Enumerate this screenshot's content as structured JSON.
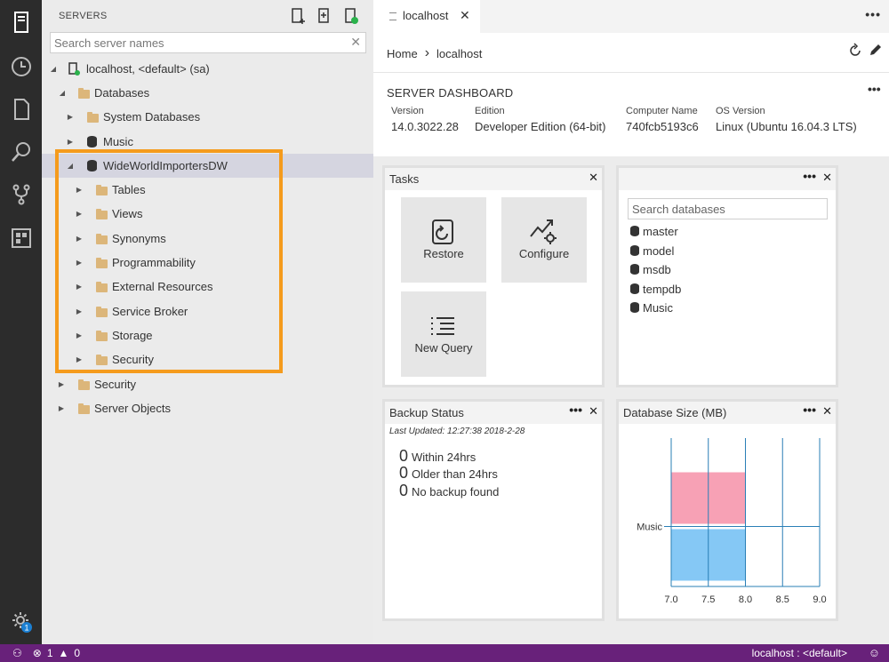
{
  "activity_bar": {
    "items": [
      "servers-icon",
      "history-icon",
      "explorer-icon",
      "search-icon",
      "source-control-icon",
      "extensions-icon"
    ],
    "settings_badge": "1"
  },
  "sidebar": {
    "title": "SERVERS",
    "search_placeholder": "Search server names",
    "tree": [
      {
        "label": "localhost, <default> (sa)",
        "icon": "server-icon",
        "expanded": true
      },
      {
        "label": "Databases",
        "icon": "folder-icon",
        "expanded": true
      },
      {
        "label": "System Databases",
        "icon": "folder-icon",
        "expanded": false
      },
      {
        "label": "Music",
        "icon": "database-icon",
        "expanded": false
      },
      {
        "label": "WideWorldImportersDW",
        "icon": "database-icon",
        "expanded": true,
        "selected": true
      },
      {
        "label": "Tables",
        "icon": "folder-icon",
        "expanded": false
      },
      {
        "label": "Views",
        "icon": "folder-icon",
        "expanded": false
      },
      {
        "label": "Synonyms",
        "icon": "folder-icon",
        "expanded": false
      },
      {
        "label": "Programmability",
        "icon": "folder-icon",
        "expanded": false
      },
      {
        "label": "External Resources",
        "icon": "folder-icon",
        "expanded": false
      },
      {
        "label": "Service Broker",
        "icon": "folder-icon",
        "expanded": false
      },
      {
        "label": "Storage",
        "icon": "folder-icon",
        "expanded": false
      },
      {
        "label": "Security",
        "icon": "folder-icon",
        "expanded": false
      },
      {
        "label": "Security",
        "icon": "folder-icon",
        "expanded": false
      },
      {
        "label": "Server Objects",
        "icon": "folder-icon",
        "expanded": false
      }
    ]
  },
  "tab": {
    "label": "localhost"
  },
  "breadcrumb": {
    "home": "Home",
    "current": "localhost"
  },
  "dashboard": {
    "title": "SERVER DASHBOARD",
    "properties": [
      {
        "key": "Version",
        "value": "14.0.3022.28"
      },
      {
        "key": "Edition",
        "value": "Developer Edition (64-bit)"
      },
      {
        "key": "Computer Name",
        "value": "740fcb5193c6"
      },
      {
        "key": "OS Version",
        "value": "Linux (Ubuntu 16.04.3 LTS)"
      }
    ]
  },
  "tasks_widget": {
    "title": "Tasks",
    "tasks": [
      {
        "label": "Restore",
        "icon": "restore-icon"
      },
      {
        "label": "Configure",
        "icon": "configure-icon"
      },
      {
        "label": "New Query",
        "icon": "new-query-icon"
      }
    ]
  },
  "databases_widget": {
    "search_placeholder": "Search databases",
    "databases": [
      "master",
      "model",
      "msdb",
      "tempdb",
      "Music"
    ]
  },
  "backup_widget": {
    "title": "Backup Status",
    "last_updated": "Last Updated: 12:27:38 2018-2-28",
    "rows": [
      {
        "count": "0",
        "label": "Within 24hrs"
      },
      {
        "count": "0",
        "label": "Older than 24hrs"
      },
      {
        "count": "0",
        "label": "No backup found"
      }
    ]
  },
  "size_widget": {
    "title": "Database Size (MB)"
  },
  "chart_data": {
    "type": "bar",
    "orientation": "horizontal",
    "categories": [
      "Music"
    ],
    "series": [
      {
        "values": [
          8.0
        ],
        "color": "#f7a1b5"
      },
      {
        "values": [
          8.0
        ],
        "color": "#85c8f5"
      }
    ],
    "xlim": [
      7.0,
      9.0
    ],
    "xticks": [
      "7.0",
      "7.5",
      "8.0",
      "8.5",
      "9.0"
    ],
    "grid": true
  },
  "statusbar": {
    "errors": "1",
    "warnings": "0",
    "connection": "localhost : <default>"
  }
}
